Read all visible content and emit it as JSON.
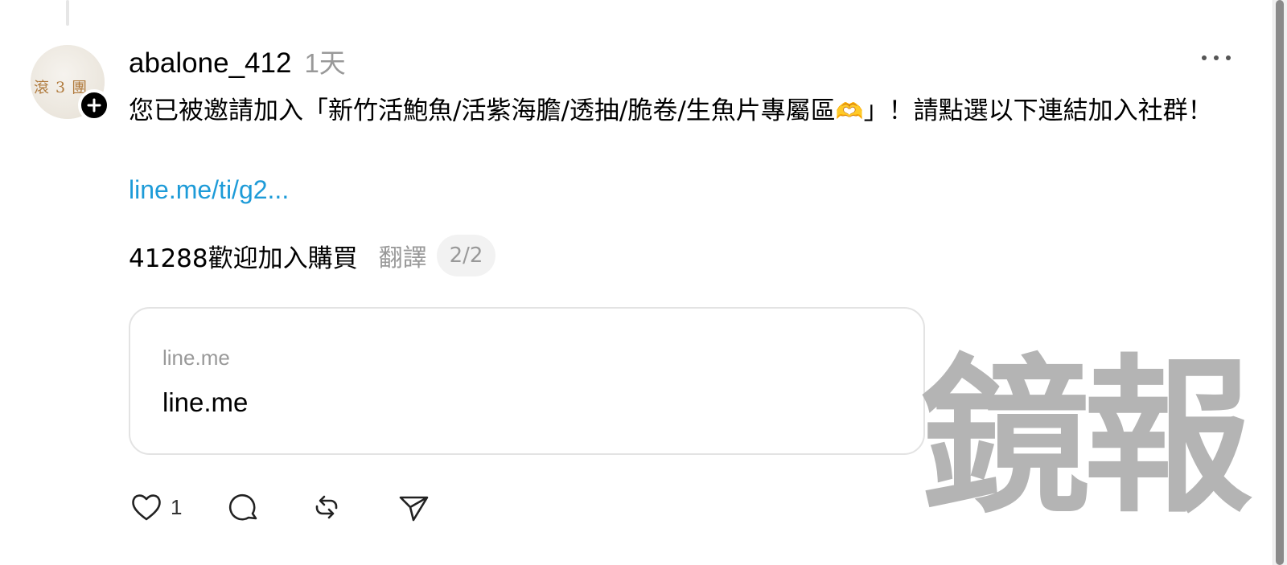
{
  "post": {
    "username": "abalone_412",
    "timestamp": "1天",
    "avatar_text": "滾 3 團",
    "text_before_emoji": "您已被邀請加入「新竹活鮑魚/活紫海膽/透抽/脆卷/生魚片專屬區",
    "emoji": "🫶",
    "text_after_emoji": "」！請點選以下連結加入社群！",
    "link_text": "line.me/ti/g2...",
    "secondary_text": "41288歡迎加入購買",
    "translate_label": "翻譯",
    "page_indicator": "2/2"
  },
  "card": {
    "domain": "line.me",
    "title": "line.me"
  },
  "actions": {
    "like_count": "1"
  },
  "watermark": "鏡報",
  "icons": {
    "follow": "plus-icon",
    "more": "more-horizontal-icon",
    "like": "heart-icon",
    "comment": "comment-icon",
    "repost": "repost-icon",
    "share": "send-icon"
  },
  "colors": {
    "link": "#1d9bd8",
    "secondary_text": "#999999",
    "watermark": "#b4b4b4"
  }
}
